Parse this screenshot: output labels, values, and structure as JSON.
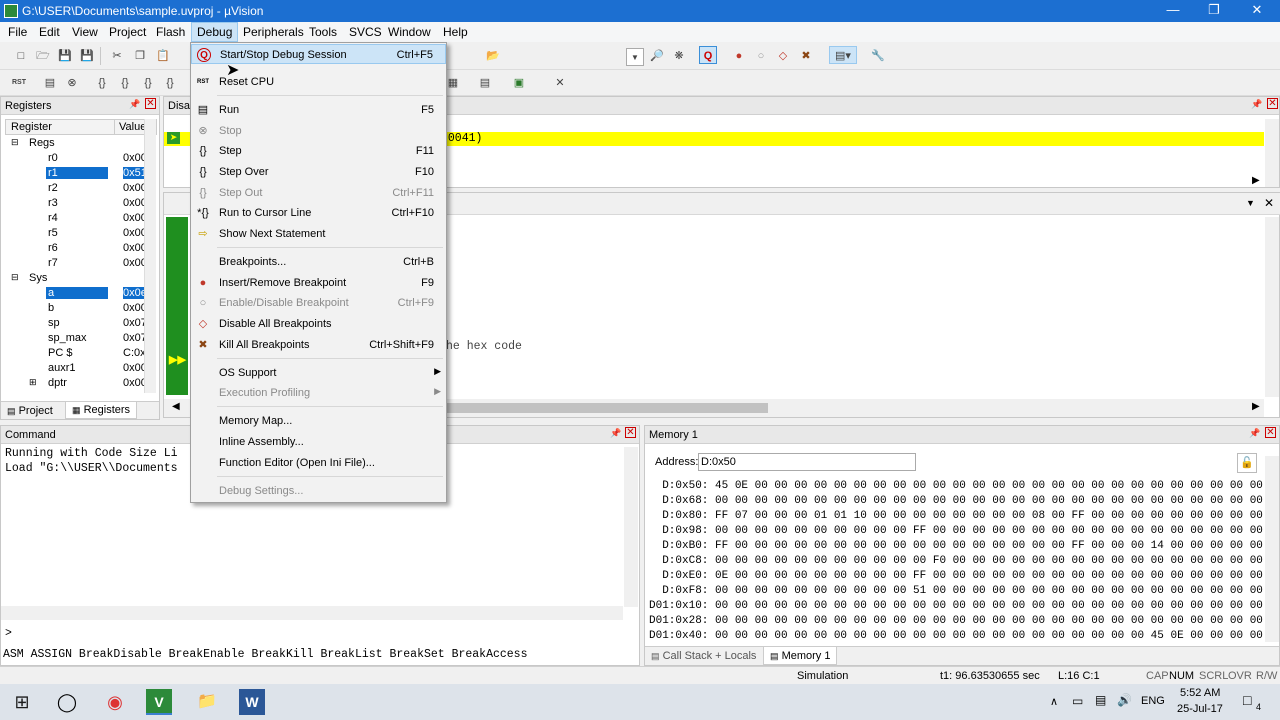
{
  "window": {
    "title": "G:\\USER\\Documents\\sample.uvproj - µVision",
    "minimize": "—",
    "maximize": "❐",
    "close": "✕"
  },
  "menubar": [
    "File",
    "Edit",
    "View",
    "Project",
    "Flash",
    "Debug",
    "Peripherals",
    "Tools",
    "SVCS",
    "Window",
    "Help"
  ],
  "registers": {
    "title": "Registers",
    "col_register": "Register",
    "col_value": "Value",
    "groups": [
      {
        "name": "Regs"
      },
      {
        "name": "Sys"
      }
    ],
    "rows": [
      {
        "name": "Regs",
        "value": ""
      },
      {
        "name": "r0",
        "value": "0x00"
      },
      {
        "name": "r1",
        "value": "0x51"
      },
      {
        "name": "r2",
        "value": "0x00"
      },
      {
        "name": "r3",
        "value": "0x00"
      },
      {
        "name": "r4",
        "value": "0x00"
      },
      {
        "name": "r5",
        "value": "0x00"
      },
      {
        "name": "r6",
        "value": "0x00"
      },
      {
        "name": "r7",
        "value": "0x00"
      },
      {
        "name": "Sys",
        "value": ""
      },
      {
        "name": "a",
        "value": "0x0e"
      },
      {
        "name": "b",
        "value": "0x00"
      },
      {
        "name": "sp",
        "value": "0x07"
      },
      {
        "name": "sp_max",
        "value": "0x07"
      },
      {
        "name": "PC  $",
        "value": "C:0x0"
      },
      {
        "name": "auxr1",
        "value": "0x00"
      },
      {
        "name": "dptr",
        "value": "0x00"
      }
    ],
    "tab_project": "Project",
    "tab_registers": "Registers"
  },
  "disassembly": {
    "title": "Disas",
    "highlight_text": ":0041)"
  },
  "editor": {
    "comment_text": "he hex code"
  },
  "command": {
    "title": "Command",
    "lines": [
      "Running with Code Size Li",
      "Load \"G:\\\\USER\\\\Documents"
    ],
    "prompt": ">",
    "hints": "ASM ASSIGN BreakDisable BreakEnable BreakKill BreakList BreakSet BreakAccess"
  },
  "memory": {
    "title": "Memory 1",
    "address_label": "Address:",
    "address_value": "D:0x50",
    "rows": [
      "  D:0x50: 45 0E 00 00 00 00 00 00 00 00 00 00 00 00 00 00 00 00 00 00 00 00 00 00 00 00 00 00 00",
      "  D:0x68: 00 00 00 00 00 00 00 00 00 00 00 00 00 00 00 00 00 00 00 00 00 00 00 00 00 00 00 00 00",
      "  D:0x80: FF 07 00 00 00 01 01 10 00 00 00 00 00 00 00 00 08 00 FF 00 00 00 00 00 00 00 00 00 FF",
      "  D:0x98: 00 00 00 00 00 00 00 00 00 00 FF 00 00 00 00 00 00 00 00 00 00 00 00 00 00 00 00 00 00",
      "  D:0xB0: FF 00 00 00 00 00 00 00 00 00 00 00 00 00 00 00 00 00 FF 00 00 00 14 00 00 00 00 00 FF",
      "  D:0xC8: 00 00 00 00 00 00 00 00 00 00 00 F0 00 00 00 00 00 00 00 00 00 00 00 00 00 00 00 00 00",
      "  D:0xE0: 0E 00 00 00 00 00 00 00 00 00 FF 00 00 00 00 00 00 00 00 00 00 00 00 00 00 00 00 00 00",
      "  D:0xF8: 00 00 00 00 00 00 00 00 00 00 51 00 00 00 00 00 00 00 00 00 00 00 00 00 00 00 00 00 00",
      "D01:0x10: 00 00 00 00 00 00 00 00 00 00 00 00 00 00 00 00 00 00 00 00 00 00 00 00 00 00 00 00 00",
      "D01:0x28: 00 00 00 00 00 00 00 00 00 00 00 00 00 00 00 00 00 00 00 00 00 00 00 00 00 00 00 00 00",
      "D01:0x40: 00 00 00 00 00 00 00 00 00 00 00 00 00 00 00 00 00 00 00 00 00 00 45 0E 00 00 00 00 00"
    ],
    "tab_callstack": "Call Stack + Locals",
    "tab_memory": "Memory 1"
  },
  "debug_menu": [
    {
      "label": "Start/Stop Debug Session",
      "shortcut": "Ctrl+F5",
      "icon": "debug-session-icon",
      "glyph": "Q",
      "disabled": false
    },
    {
      "label": "Reset CPU",
      "shortcut": "",
      "icon": "reset-cpu-icon",
      "glyph": "RST",
      "disabled": false
    },
    {
      "label": "Run",
      "shortcut": "F5",
      "icon": "run-icon",
      "glyph": "▤",
      "disabled": false
    },
    {
      "label": "Stop",
      "shortcut": "",
      "icon": "stop-icon",
      "glyph": "⊗",
      "disabled": true
    },
    {
      "label": "Step",
      "shortcut": "F11",
      "icon": "step-icon",
      "glyph": "{}",
      "disabled": false
    },
    {
      "label": "Step Over",
      "shortcut": "F10",
      "icon": "step-over-icon",
      "glyph": "{}",
      "disabled": false
    },
    {
      "label": "Step Out",
      "shortcut": "Ctrl+F11",
      "icon": "step-out-icon",
      "glyph": "{}",
      "disabled": true
    },
    {
      "label": "Run to Cursor Line",
      "shortcut": "Ctrl+F10",
      "icon": "run-to-cursor-icon",
      "glyph": "*{}",
      "disabled": false
    },
    {
      "label": "Show Next Statement",
      "shortcut": "",
      "icon": "show-next-statement-icon",
      "glyph": "⇨",
      "disabled": false
    },
    {
      "label": "Breakpoints...",
      "shortcut": "Ctrl+B",
      "icon": "",
      "glyph": "",
      "disabled": false
    },
    {
      "label": "Insert/Remove Breakpoint",
      "shortcut": "F9",
      "icon": "breakpoint-icon",
      "glyph": "●",
      "disabled": false
    },
    {
      "label": "Enable/Disable Breakpoint",
      "shortcut": "Ctrl+F9",
      "icon": "breakpoint-disabled-icon",
      "glyph": "○",
      "disabled": true
    },
    {
      "label": "Disable All Breakpoints",
      "shortcut": "",
      "icon": "disable-all-breakpoints-icon",
      "glyph": "◇",
      "disabled": false
    },
    {
      "label": "Kill All Breakpoints",
      "shortcut": "Ctrl+Shift+F9",
      "icon": "kill-all-breakpoints-icon",
      "glyph": "✖",
      "disabled": false
    },
    {
      "label": "OS Support",
      "shortcut": "",
      "icon": "",
      "glyph": "",
      "disabled": false,
      "submenu": true
    },
    {
      "label": "Execution Profiling",
      "shortcut": "",
      "icon": "",
      "glyph": "",
      "disabled": true,
      "submenu": true
    },
    {
      "label": "Memory Map...",
      "shortcut": "",
      "icon": "",
      "glyph": "",
      "disabled": false
    },
    {
      "label": "Inline Assembly...",
      "shortcut": "",
      "icon": "",
      "glyph": "",
      "disabled": false
    },
    {
      "label": "Function Editor (Open Ini File)...",
      "shortcut": "",
      "icon": "",
      "glyph": "",
      "disabled": false
    },
    {
      "label": "Debug Settings...",
      "shortcut": "",
      "icon": "",
      "glyph": "",
      "disabled": true
    }
  ],
  "statusbar": {
    "mode": "Simulation",
    "time": "t1: 96.63530655 sec",
    "position": "L:16 C:1",
    "flags": [
      "CAP",
      "NUM",
      "SCRL",
      "OVR",
      "R/W"
    ]
  },
  "taskbar": {
    "time": "5:52 AM",
    "date": "25-Jul-17",
    "lang": "ENG",
    "notif_count": "4"
  },
  "colors": {
    "titlebar": "#1c6fd1",
    "highlight_line": "#ffff00",
    "selection": "#0f6ecd",
    "debug_green": "#1f8f1f"
  }
}
